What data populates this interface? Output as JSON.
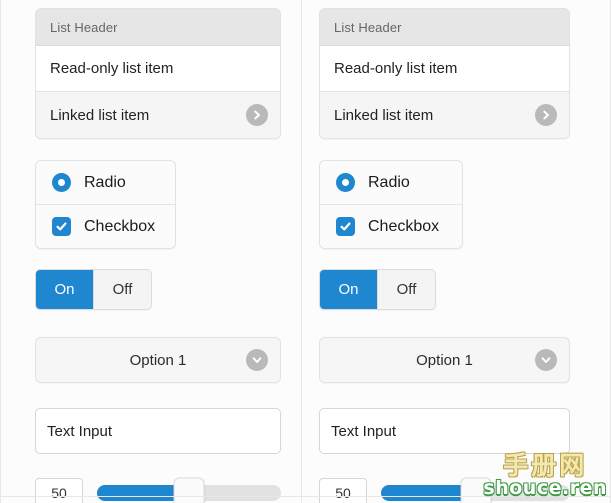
{
  "panels": [
    {
      "id": "left",
      "list": {
        "header": "List Header",
        "items": [
          {
            "label": "Read-only list item",
            "type": "readonly",
            "icon": null
          },
          {
            "label": "Linked list item",
            "type": "linked",
            "icon": "chevron-right-icon"
          }
        ]
      },
      "choices": [
        {
          "label": "Radio",
          "control": "radio",
          "checked": true
        },
        {
          "label": "Checkbox",
          "control": "checkbox",
          "checked": true
        }
      ],
      "segmented": {
        "options": [
          "On",
          "Off"
        ],
        "selected": "On"
      },
      "select": {
        "value": "Option 1",
        "icon": "chevron-down-icon"
      },
      "text_input": {
        "value": "Text Input",
        "placeholder": "Text Input"
      },
      "slider": {
        "value": "50",
        "percent": 50,
        "min": 0,
        "max": 100
      }
    },
    {
      "id": "right",
      "list": {
        "header": "List Header",
        "items": [
          {
            "label": "Read-only list item",
            "type": "readonly",
            "icon": null
          },
          {
            "label": "Linked list item",
            "type": "linked",
            "icon": "chevron-right-icon"
          }
        ]
      },
      "choices": [
        {
          "label": "Radio",
          "control": "radio",
          "checked": true
        },
        {
          "label": "Checkbox",
          "control": "checkbox",
          "checked": true
        }
      ],
      "segmented": {
        "options": [
          "On",
          "Off"
        ],
        "selected": "On"
      },
      "select": {
        "value": "Option 1",
        "icon": "chevron-down-icon"
      },
      "text_input": {
        "value": "Text Input",
        "placeholder": "Text Input"
      },
      "slider": {
        "value": "50",
        "percent": 50,
        "min": 0,
        "max": 100
      }
    }
  ],
  "watermark": {
    "cn": "手册网",
    "en": "shouce.ren"
  },
  "colors": {
    "accent": "#1f86d0",
    "page_bg": "#fcfcfc",
    "card_bg": "#f7f7f7",
    "list_header_bg": "#e6e6e6",
    "icon_circle": "#b9b9b9",
    "border": "#e2e2e2"
  }
}
